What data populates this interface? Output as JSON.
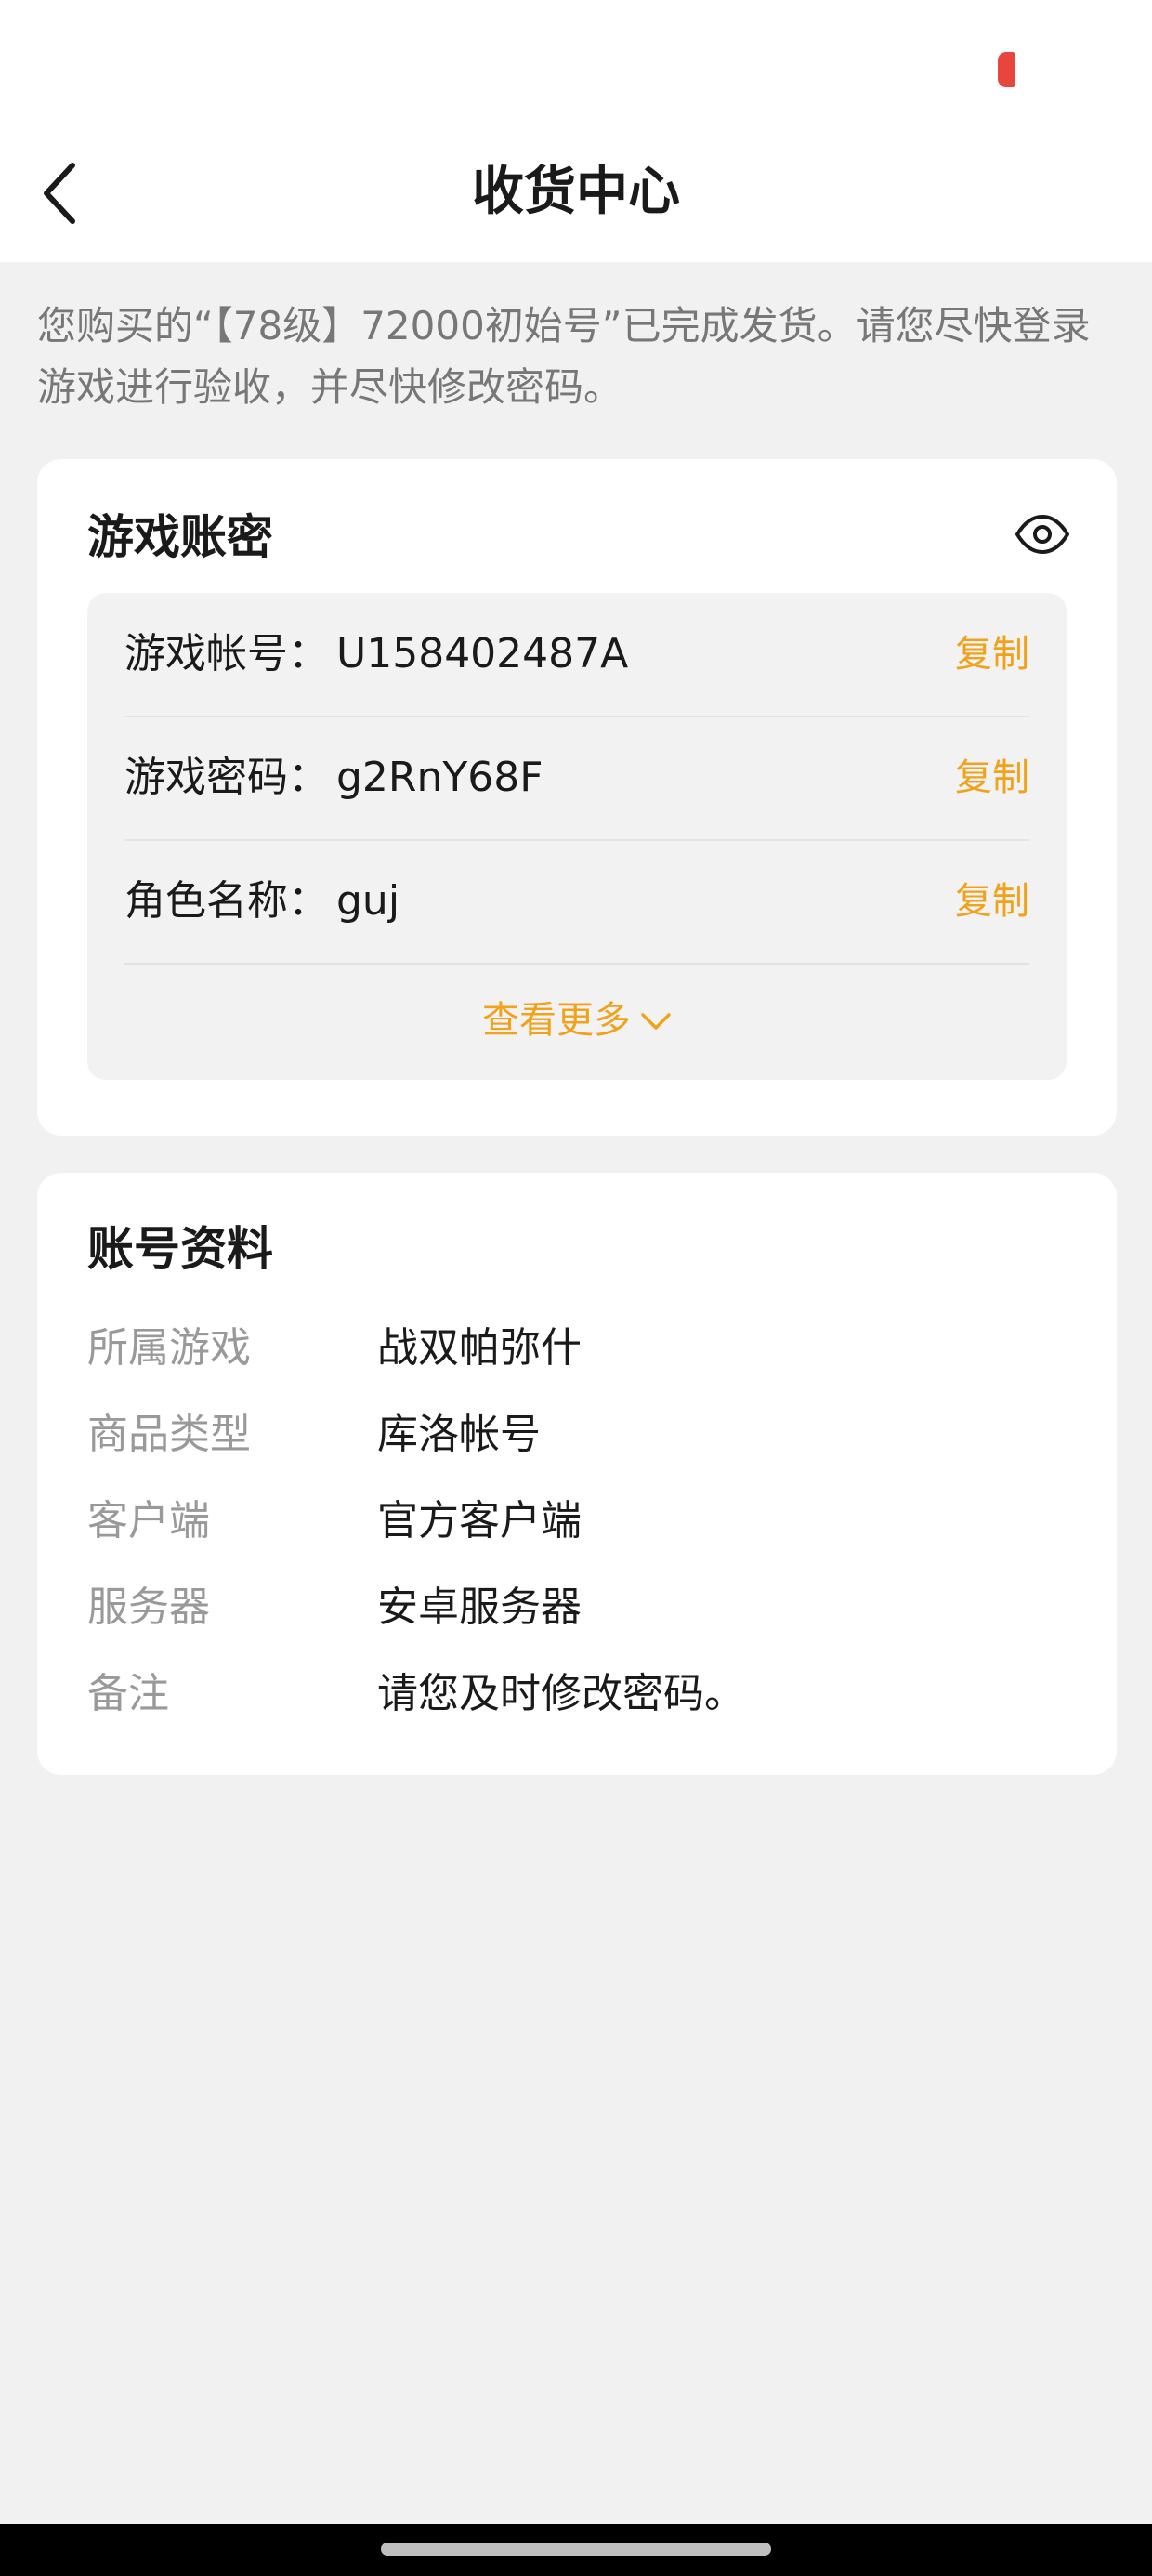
{
  "header": {
    "title": "收货中心"
  },
  "notice": {
    "text": "您购买的“【78级】72000初始号”已完成发货。请您尽快登录游戏进行验收，并尽快修改密码。"
  },
  "credentials": {
    "title": "游戏账密",
    "toggle_icon": "eye-icon",
    "rows": [
      {
        "label": "游戏帐号：",
        "value": "U158402487A",
        "copy_label": "复制"
      },
      {
        "label": "游戏密码：",
        "value": "g2RnY68F",
        "copy_label": "复制"
      },
      {
        "label": "角色名称：",
        "value": "guj",
        "copy_label": "复制"
      }
    ],
    "view_more_label": "查看更多"
  },
  "profile": {
    "title": "账号资料",
    "rows": [
      {
        "label": "所属游戏",
        "value": "战双帕弥什"
      },
      {
        "label": "商品类型",
        "value": "库洛帐号"
      },
      {
        "label": "客户端",
        "value": "官方客户端"
      },
      {
        "label": "服务器",
        "value": "安卓服务器"
      },
      {
        "label": "备注",
        "value": "请您及时修改密码。"
      }
    ]
  },
  "colors": {
    "accent": "#f0a21a",
    "status_indicator": "#e8453c",
    "page_background": "#f1f1f1"
  }
}
